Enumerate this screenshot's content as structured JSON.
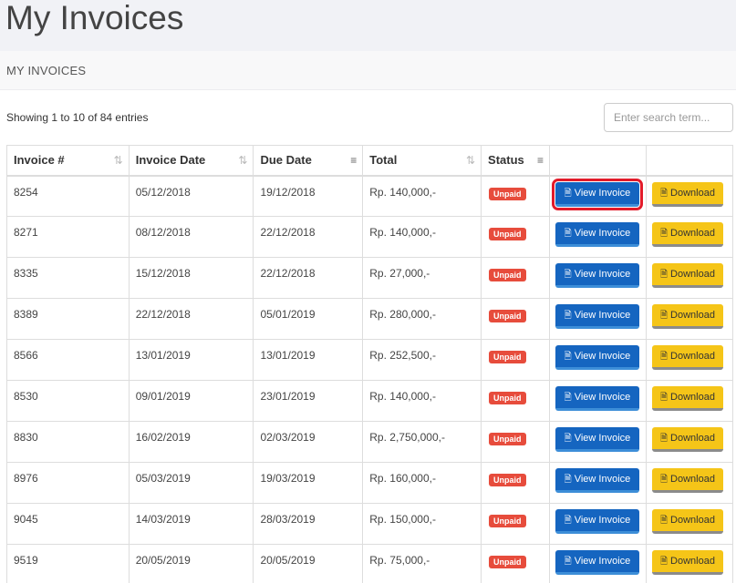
{
  "header": {
    "title": "My Invoices"
  },
  "breadcrumb": "MY INVOICES",
  "info": {
    "showing": "Showing 1 to 10 of 84 entries"
  },
  "search": {
    "placeholder": "Enter search term..."
  },
  "table": {
    "columns": [
      {
        "label": "Invoice #",
        "sort_icon": "sort-icon",
        "sort_glyph": "⇅",
        "active": false
      },
      {
        "label": "Invoice Date",
        "sort_icon": "sort-icon",
        "sort_glyph": "⇅",
        "active": false
      },
      {
        "label": "Due Date",
        "sort_icon": "sort-desc-icon",
        "sort_glyph": "≡",
        "active": true
      },
      {
        "label": "Total",
        "sort_icon": "sort-icon",
        "sort_glyph": "⇅",
        "active": false
      },
      {
        "label": "Status",
        "sort_icon": "sort-desc-icon",
        "sort_glyph": "≡",
        "active": true
      },
      {
        "label": "",
        "sort_icon": "",
        "sort_glyph": "",
        "active": false
      },
      {
        "label": "",
        "sort_icon": "",
        "sort_glyph": "",
        "active": false
      }
    ],
    "rows": [
      {
        "invoice": "8254",
        "date": "05/12/2018",
        "due": "19/12/2018",
        "total": "Rp. 140,000,-",
        "status": "Unpaid",
        "highlight": true
      },
      {
        "invoice": "8271",
        "date": "08/12/2018",
        "due": "22/12/2018",
        "total": "Rp. 140,000,-",
        "status": "Unpaid",
        "highlight": false
      },
      {
        "invoice": "8335",
        "date": "15/12/2018",
        "due": "22/12/2018",
        "total": "Rp. 27,000,-",
        "status": "Unpaid",
        "highlight": false
      },
      {
        "invoice": "8389",
        "date": "22/12/2018",
        "due": "05/01/2019",
        "total": "Rp. 280,000,-",
        "status": "Unpaid",
        "highlight": false
      },
      {
        "invoice": "8566",
        "date": "13/01/2019",
        "due": "13/01/2019",
        "total": "Rp. 252,500,-",
        "status": "Unpaid",
        "highlight": false
      },
      {
        "invoice": "8530",
        "date": "09/01/2019",
        "due": "23/01/2019",
        "total": "Rp. 140,000,-",
        "status": "Unpaid",
        "highlight": false
      },
      {
        "invoice": "8830",
        "date": "16/02/2019",
        "due": "02/03/2019",
        "total": "Rp. 2,750,000,-",
        "status": "Unpaid",
        "highlight": false
      },
      {
        "invoice": "8976",
        "date": "05/03/2019",
        "due": "19/03/2019",
        "total": "Rp. 160,000,-",
        "status": "Unpaid",
        "highlight": false
      },
      {
        "invoice": "9045",
        "date": "14/03/2019",
        "due": "28/03/2019",
        "total": "Rp. 150,000,-",
        "status": "Unpaid",
        "highlight": false
      },
      {
        "invoice": "9519",
        "date": "20/05/2019",
        "due": "20/05/2019",
        "total": "Rp. 75,000,-",
        "status": "Unpaid",
        "highlight": false
      }
    ],
    "view_label": "View Invoice",
    "download_label": "Download"
  },
  "colors": {
    "view_button": "#1565c0",
    "download_button": "#f5c518",
    "unpaid_badge": "#e74c3c",
    "highlight": "#e21b2a"
  },
  "icons": {
    "view": "file-icon",
    "download": "file-download-icon"
  }
}
